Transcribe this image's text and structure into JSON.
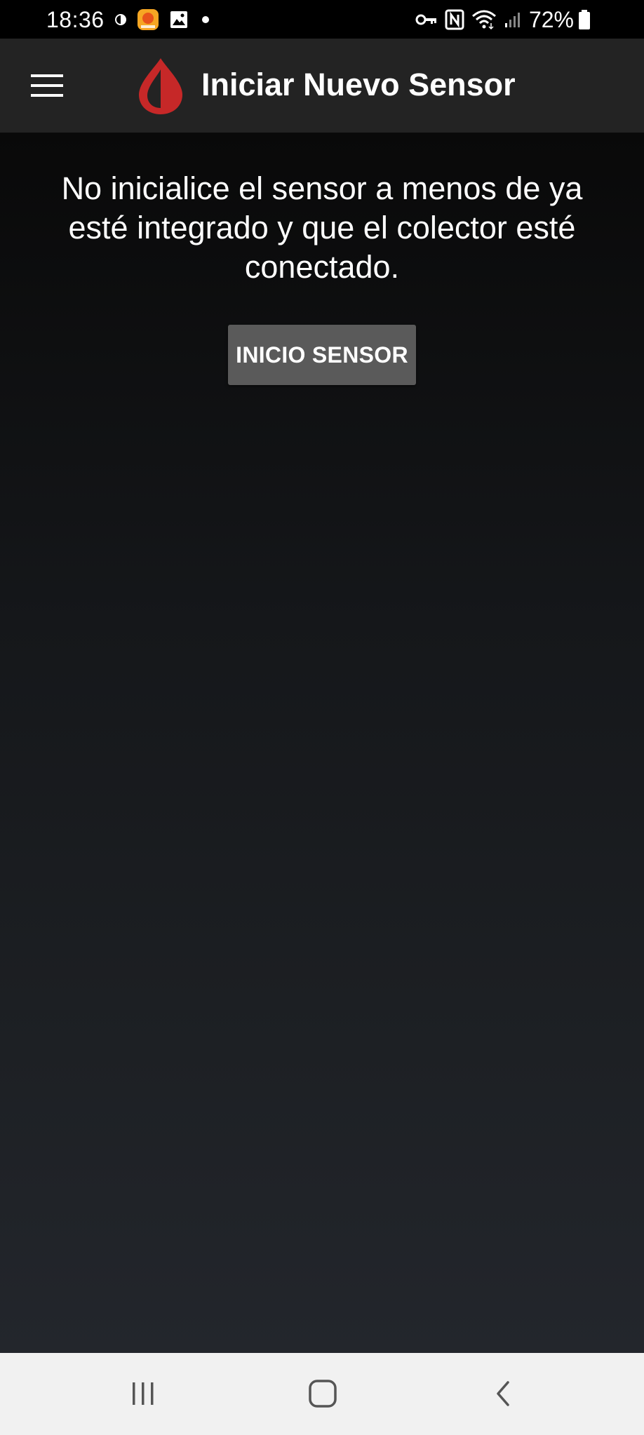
{
  "status_bar": {
    "time": "18:36",
    "left_icons": [
      "contrast-icon",
      "app-notification-icon",
      "gallery-icon",
      "dot-icon"
    ],
    "right_icons": [
      "vpn-key-icon",
      "nfc-icon",
      "wifi-icon",
      "signal-icon",
      "battery-icon"
    ],
    "battery_percent": "72%"
  },
  "app_bar": {
    "title": "Iniciar Nuevo Sensor",
    "menu_icon": "hamburger-menu-icon",
    "logo_icon": "blood-drop-logo-icon"
  },
  "main": {
    "message": "No inicialice el sensor a menos de ya esté integrado y que el colector esté conectado.",
    "start_button_label": "INICIO SENSOR"
  },
  "nav_bar": {
    "recents_icon": "recents-icon",
    "home_icon": "home-icon",
    "back_icon": "back-icon"
  },
  "colors": {
    "app_bar_bg": "#232323",
    "button_bg": "#5a5a5a",
    "logo_red": "#c62828",
    "nav_bg": "#f1f1f1"
  }
}
